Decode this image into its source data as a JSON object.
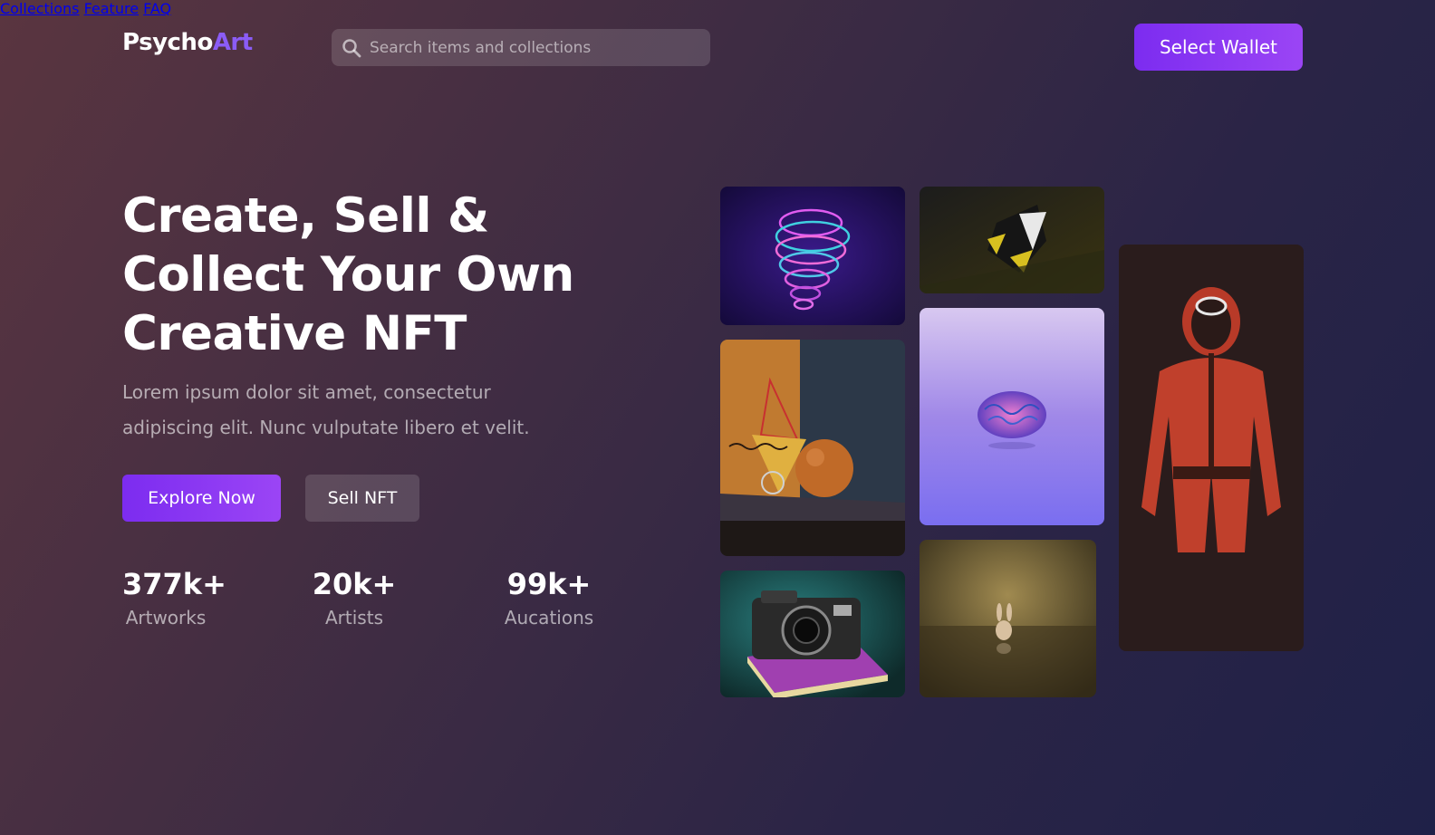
{
  "header": {
    "logo_part1": "Psycho",
    "logo_part2": "Art",
    "search_placeholder": "Search items and collections",
    "nav": [
      "Collections",
      "Feature",
      "FAQ"
    ],
    "wallet_label": "Select Wallet"
  },
  "hero": {
    "title_line1": "Create, Sell &",
    "title_line2": "Collect Your Own",
    "title_line3": "Creative NFT",
    "description_line1": "Lorem ipsum dolor sit amet, consectetur",
    "description_line2": "adipiscing elit. Nunc vulputate libero et velit.",
    "explore_label": "Explore Now",
    "sell_label": "Sell NFT"
  },
  "stats": [
    {
      "value": "377k+",
      "label": "Artworks"
    },
    {
      "value": "20k+",
      "label": "Artists"
    },
    {
      "value": "99k+",
      "label": "Aucations"
    }
  ],
  "gallery": [
    {
      "name": "neon-skull-art"
    },
    {
      "name": "yellow-geometric-art"
    },
    {
      "name": "orange-sphere-art"
    },
    {
      "name": "brain-art"
    },
    {
      "name": "red-suit-figure-art"
    },
    {
      "name": "camera-book-art"
    },
    {
      "name": "bunny-figure-art"
    }
  ],
  "colors": {
    "accent": "#8b5cf6",
    "button_gradient_start": "#7c2cf0",
    "button_gradient_end": "#9b45f5"
  }
}
